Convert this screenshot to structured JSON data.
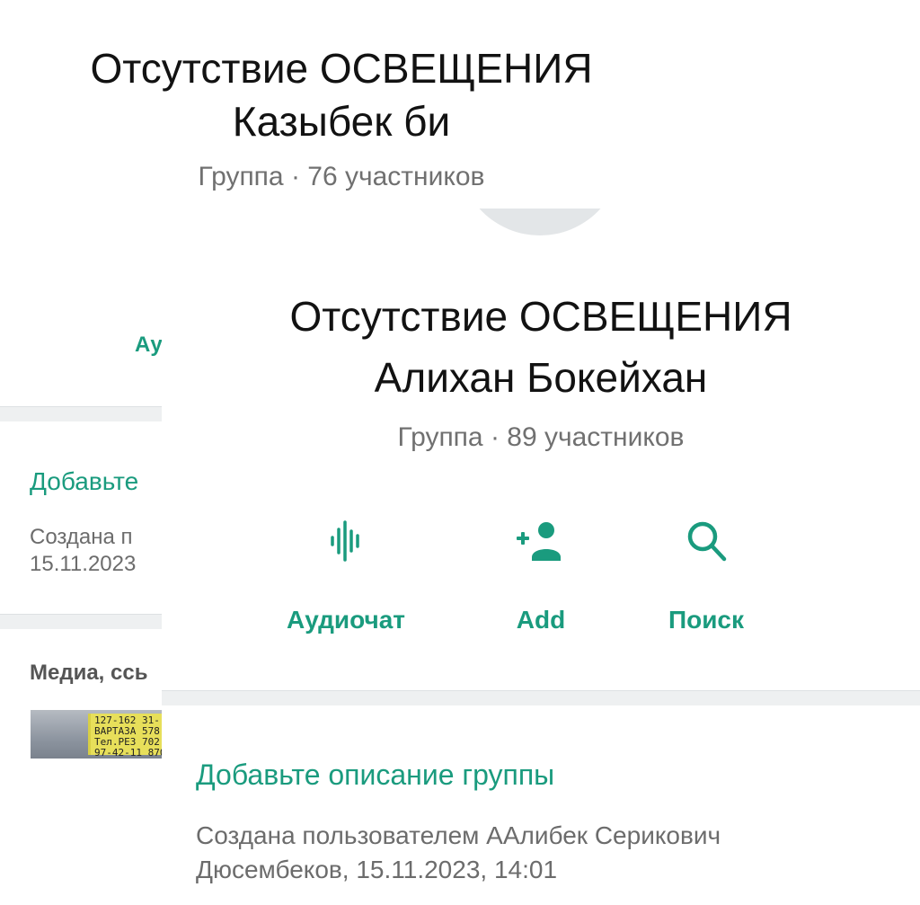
{
  "background_screen": {
    "title_line1": "Отсутствие ОСВЕЩЕНИЯ",
    "title_line2": "Казыбек би",
    "subtitle": "Группа · 76 участников",
    "audio_label_partial": "Ау",
    "description_link_partial": "Добавьте",
    "created_line1_partial": "Создана п",
    "created_line2_partial": "15.11.2023",
    "media_header_partial": "Медиа, ссь",
    "media_thumb_text": [
      "127-162 31-",
      "ВАРТАЗА 578",
      "Тел.РЕЗ 702",
      "97-42-11 870"
    ]
  },
  "foreground_screen": {
    "title_line1": "Отсутствие ОСВЕЩЕНИЯ",
    "title_line2": "Алихан Бокейхан",
    "subtitle": "Группа · 89 участников",
    "actions": [
      {
        "label": "Аудиочат",
        "icon": "audio-waveform-icon"
      },
      {
        "label": "Add",
        "icon": "add-person-icon"
      },
      {
        "label": "Поиск",
        "icon": "search-icon"
      }
    ],
    "description_link": "Добавьте описание группы",
    "created_line1": "Создана пользователем ААлибек Серикович",
    "created_line2": "Дюсембеков, 15.11.2023, 14:01"
  },
  "colors": {
    "accent": "#1a9b7e",
    "secondary_text": "#707070",
    "divider": "#eef0f1"
  }
}
